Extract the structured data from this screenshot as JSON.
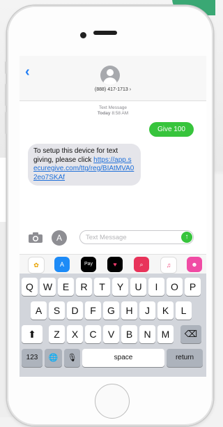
{
  "contact": {
    "number": "(888) 417-1713",
    "chevron": "›"
  },
  "thread": {
    "timestamp_label": "Text Message",
    "timestamp_day": "Today",
    "timestamp_time": "8:58 AM",
    "outgoing": "Give 100",
    "incoming_text": "To setup this device for text giving, please click ",
    "incoming_link": "https://app.securegive.com/ttg/reg/BIAtMVA02eo7SKAf"
  },
  "input": {
    "placeholder": "Text Message",
    "send_glyph": "↑"
  },
  "nav": {
    "back_glyph": "‹"
  },
  "appstrip": [
    {
      "name": "photos",
      "glyph": "✿",
      "color": "#ffffff"
    },
    {
      "name": "app-store",
      "glyph": "A",
      "color": "#1d8bf7"
    },
    {
      "name": "apple-pay",
      "glyph": "Pay",
      "color": "#000000"
    },
    {
      "name": "digital-touch",
      "glyph": "♥",
      "color": "#000000"
    },
    {
      "name": "search",
      "glyph": "⌕",
      "color": "#e8335a"
    },
    {
      "name": "music",
      "glyph": "♫",
      "color": "#ffffff"
    },
    {
      "name": "animoji",
      "glyph": "☻",
      "color": "#f04ba4"
    }
  ],
  "keyboard": {
    "row1": [
      "Q",
      "W",
      "E",
      "R",
      "T",
      "Y",
      "U",
      "I",
      "O",
      "P"
    ],
    "row2": [
      "A",
      "S",
      "D",
      "F",
      "G",
      "H",
      "J",
      "K",
      "L"
    ],
    "row3": [
      "Z",
      "X",
      "C",
      "V",
      "B",
      "N",
      "M"
    ],
    "numbers": "123",
    "space": "space",
    "return": "return",
    "shift": "⬆",
    "delete": "⌫",
    "globe": "🌐",
    "mic": "🎙"
  },
  "colors": {
    "imessage_green": "#37c43c",
    "link_blue": "#1e6fd9",
    "ios_blue": "#1e7cf5"
  }
}
